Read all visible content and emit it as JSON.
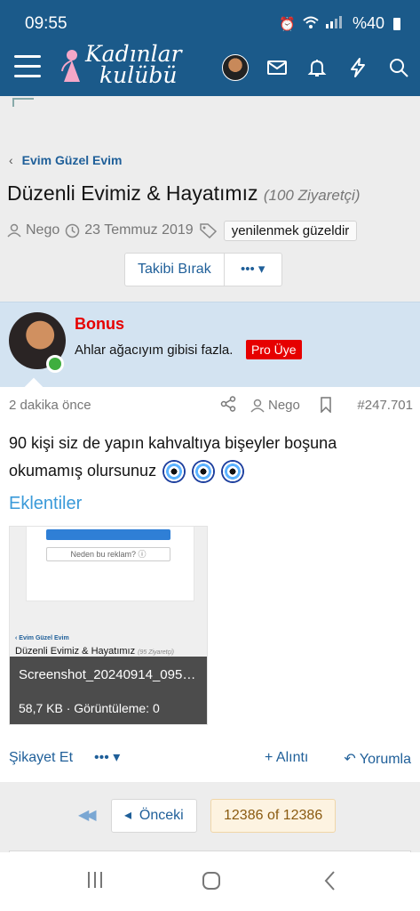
{
  "status_bar": {
    "time": "09:55",
    "battery": "%40"
  },
  "header": {
    "logo_line1": "Kadınlar",
    "logo_line2": "kulübü"
  },
  "breadcrumb": {
    "label": "Evim Güzel Evim"
  },
  "thread": {
    "title": "Düzenli Evimiz & Hayatımız",
    "views": "(100 Ziyaretçi)",
    "author": "Nego",
    "date": "23 Temmuz 2019",
    "tag": "yenilenmek güzeldir",
    "follow_label": "Takibi Bırak",
    "more_label": "•••"
  },
  "post": {
    "username": "Bonus",
    "user_title": "Ahlar ağacıyım gibisi fazla.",
    "badge": "Pro Üye",
    "time_ago": "2 dakika önce",
    "author": "Nego",
    "post_number": "#247.701",
    "text": "90 kişi siz de yapın kahvaltıya bişeyler boşuna okumamış olursunuz",
    "attachments_heading": "Eklentiler",
    "attachment": {
      "filename": "Screenshot_20240914_095…",
      "meta": "58,7 KB · Görüntüleme: 0",
      "preview_why": "Neden bu reklam? ⓘ",
      "preview_crumb": "‹ Evim Güzel Evim",
      "preview_title": "Düzenli Evimiz & Hayatımız",
      "preview_views": "(95 Ziyaretçi)"
    },
    "report_label": "Şikayet Et",
    "more_label": "•••",
    "quote_label": "+ Alıntı",
    "reply_label": "Yorumla"
  },
  "pagination": {
    "first": "◀◀",
    "prev_label": "Önceki",
    "current": "12386 of 12386"
  },
  "colors": {
    "header_bg": "#1b5a8a",
    "link": "#1f5f99",
    "user_red": "#e60000",
    "card_bg": "#d3e3f1"
  }
}
